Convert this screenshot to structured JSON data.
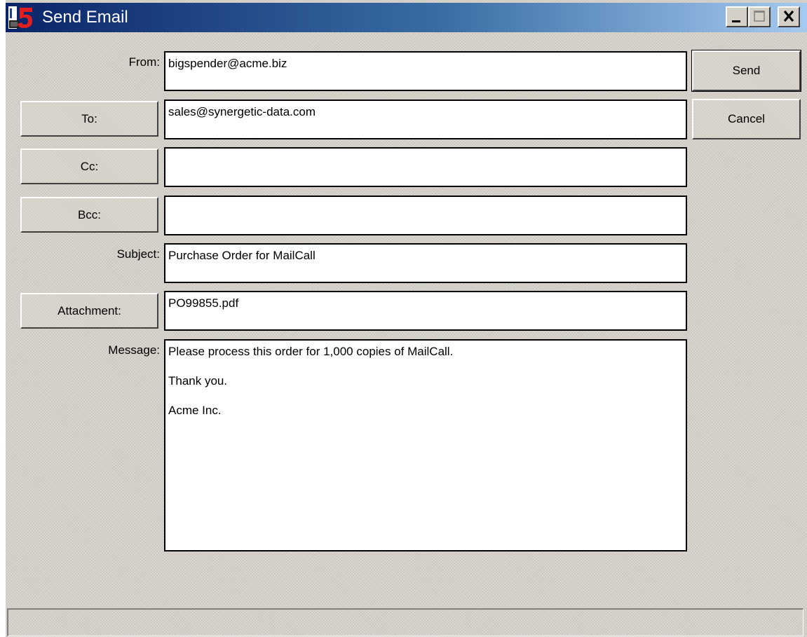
{
  "window": {
    "title": "Send Email",
    "icon": "app-5-icon"
  },
  "titlebar_buttons": {
    "minimize": "minimize-icon",
    "maximize": "maximize-icon",
    "close": "close-icon"
  },
  "form": {
    "from_label": "From:",
    "from_value": "bigspender@acme.biz",
    "to_button": "To:",
    "to_value": "sales@synergetic-data.com",
    "cc_button": "Cc:",
    "cc_value": "",
    "bcc_button": "Bcc:",
    "bcc_value": "",
    "subject_label": "Subject:",
    "subject_value": "Purchase Order for MailCall",
    "attachment_button": "Attachment:",
    "attachment_value": "PO99855.pdf",
    "message_label": "Message:",
    "message_lines": [
      "Please process this order for 1,000 copies of MailCall.",
      "Thank you.",
      "Acme Inc."
    ]
  },
  "actions": {
    "send": "Send",
    "cancel": "Cancel"
  },
  "statusbar": {
    "text": ""
  },
  "colors": {
    "title_gradient_start": "#0a246a",
    "title_gradient_end": "#a6caf0",
    "window_face": "#d4d0c8"
  }
}
